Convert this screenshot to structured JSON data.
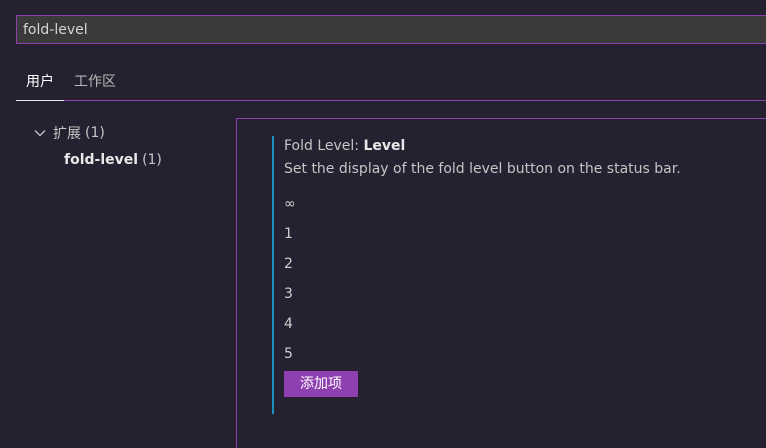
{
  "search": {
    "value": "fold-level"
  },
  "tabs": [
    {
      "label": "用户"
    },
    {
      "label": "工作区"
    }
  ],
  "toc": {
    "parent_label": "扩展",
    "parent_count": "(1)",
    "child_label": "fold-level",
    "child_count": "(1)"
  },
  "setting": {
    "category": "Fold Level: ",
    "name": "Level",
    "description": "Set the display of the fold level button on the status bar.",
    "values": [
      "∞",
      "1",
      "2",
      "3",
      "4",
      "5"
    ],
    "add_label": "添加项"
  },
  "colors": {
    "accent": "#8e3fb0",
    "modified_bar": "#1e8fbf",
    "background": "#262130"
  }
}
